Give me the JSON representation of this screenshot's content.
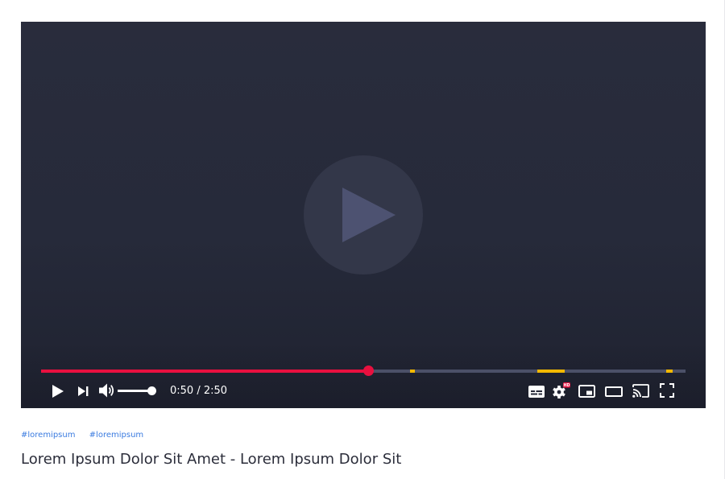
{
  "player": {
    "current_time": "0:50",
    "duration": "2:50",
    "time_separator": "/",
    "progress_fraction": 0.508,
    "volume_fraction": 0.8,
    "chapter_markers": [
      {
        "start": 0.572,
        "end": 0.58
      },
      {
        "start": 0.77,
        "end": 0.812
      },
      {
        "start": 0.97,
        "end": 0.98
      }
    ],
    "colors": {
      "played": "#e8103f",
      "track": "#4b5068",
      "marker": "#f2b800",
      "hd_badge": "#e8103f"
    },
    "hd_badge_label": "HD",
    "icons": {
      "big_play": "play-icon",
      "play": "play-icon",
      "next": "skip-next-icon",
      "volume": "volume-icon",
      "subtitles": "subtitles-icon",
      "settings": "settings-gear-icon",
      "miniplayer": "miniplayer-icon",
      "theater": "theater-mode-icon",
      "cast": "cast-icon",
      "fullscreen": "fullscreen-icon"
    }
  },
  "video": {
    "tags": [
      "#loremipsum",
      "#loremipsum"
    ],
    "title": "Lorem Ipsum Dolor Sit Amet - Lorem Ipsum Dolor Sit"
  }
}
